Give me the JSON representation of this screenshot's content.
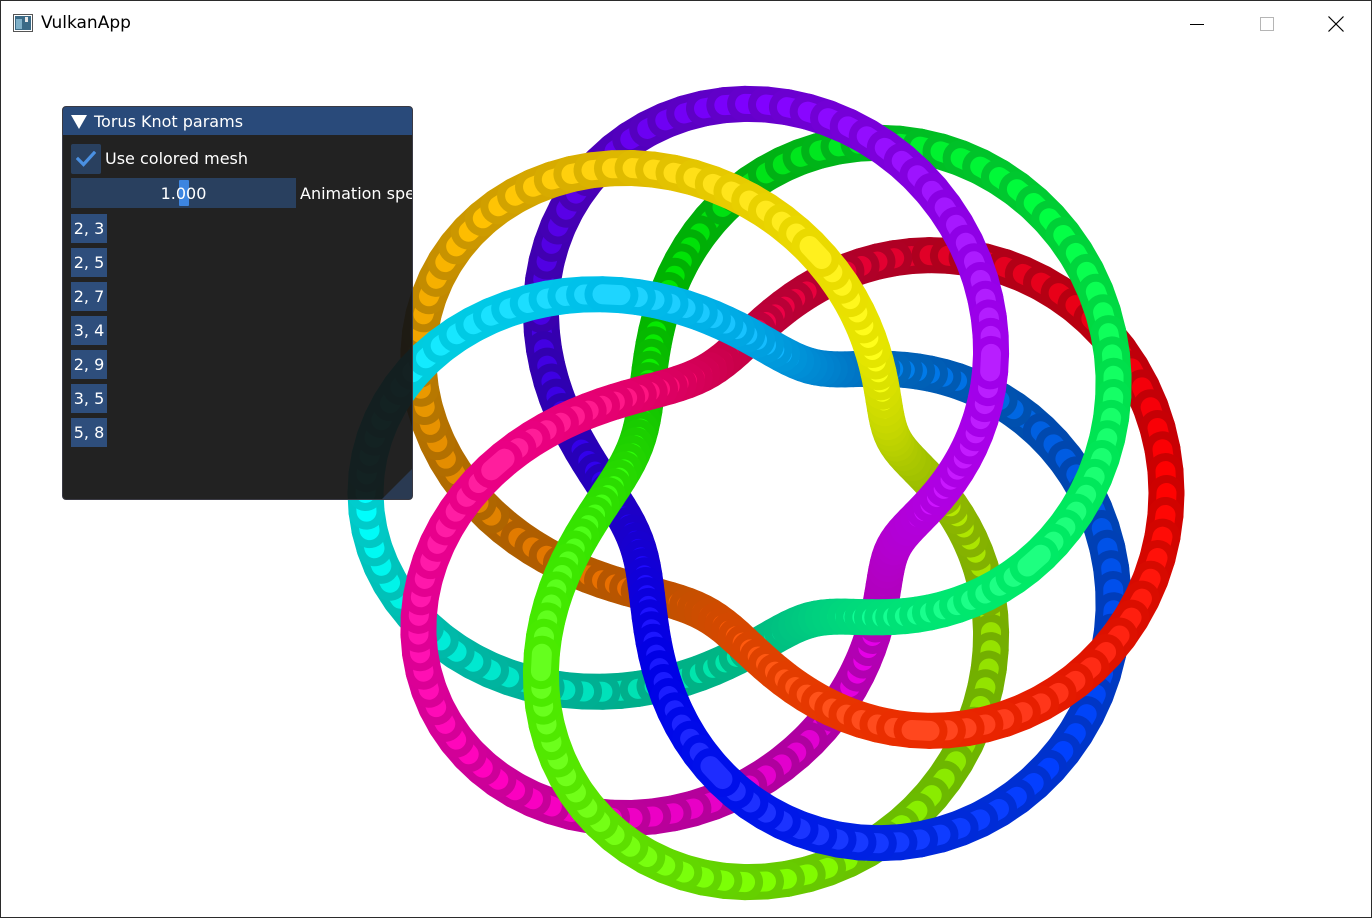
{
  "window": {
    "title": "VulkanApp"
  },
  "panel": {
    "title": "Torus Knot params",
    "checkbox_label": "Use colored mesh",
    "checkbox_checked": true,
    "slider_value": "1.000",
    "slider_fraction": 0.5,
    "slider_label": "Animation speed",
    "buttons": [
      "2, 3",
      "2, 5",
      "2, 7",
      "3, 4",
      "2, 9",
      "3, 5",
      "5, 8"
    ]
  },
  "scene": {
    "knot": "torus knot (5, 8)",
    "colored_mesh": true,
    "background_color": "#ffffff"
  },
  "colors": {
    "title_bar": "#294a7a",
    "widget_bg": "#29405f",
    "button_bg": "#2e4e7c",
    "accent": "#3d85e0",
    "panel_bg": "#141414"
  }
}
